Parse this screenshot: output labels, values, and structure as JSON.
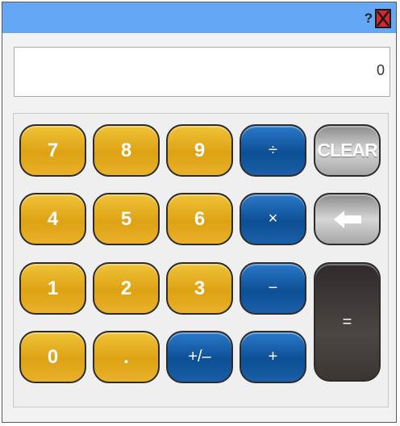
{
  "titlebar": {
    "help_label": "?",
    "close_icon": "close-x-icon"
  },
  "display": {
    "value": "0"
  },
  "keys": {
    "k7": "7",
    "k8": "8",
    "k9": "9",
    "divide": "÷",
    "clear": "CLEAR",
    "k4": "4",
    "k5": "5",
    "k6": "6",
    "multiply": "×",
    "backspace_icon": "left-arrow-icon",
    "k1": "1",
    "k2": "2",
    "k3": "3",
    "minus": "−",
    "equals": "=",
    "k0": "0",
    "decimal": ".",
    "negate": "+/–",
    "plus": "+"
  },
  "colors": {
    "titlebar": "#64a7f5",
    "number_key": "#e3aa1e",
    "operator_key": "#0d4f95",
    "clear_key": "#a6a6a6",
    "equals_key": "#3a3634",
    "close_button": "#d8262b"
  }
}
